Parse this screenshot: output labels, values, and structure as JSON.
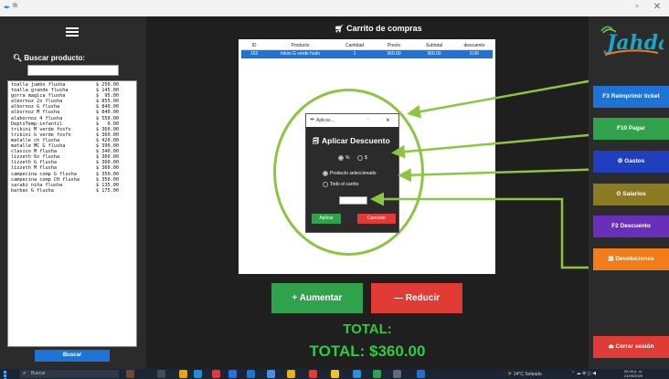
{
  "window": {
    "title": "tk",
    "minimize_label": "▫",
    "close_label": "✕"
  },
  "sidebar_left": {
    "search_label": "Buscar producto:",
    "search_value": "",
    "products": [
      {
        "name": "toalla jumbo flusha",
        "price": "$ 250.00"
      },
      {
        "name": "toalla grande flusha",
        "price": "$ 145.00"
      },
      {
        "name": "gorra magica flusha",
        "price": "$  95.00"
      },
      {
        "name": "albornoz 2x flusha",
        "price": "$ 855.00"
      },
      {
        "name": "albornoz G flusha",
        "price": "$ 840.00"
      },
      {
        "name": "albornoz M flusha",
        "price": "$ 840.00"
      },
      {
        "name": "alabornoz 4 flusha",
        "price": "$ 550.00"
      },
      {
        "name": "DeptoTemp-infantil",
        "price": "$   0.00"
      },
      {
        "name": "trikini M  verde fosfo",
        "price": "$ 360.00"
      },
      {
        "name": "trikini G verde fosfo",
        "price": "$ 360.00"
      },
      {
        "name": "matalle ch flusha",
        "price": "$ 420.00"
      },
      {
        "name": "matalle MC G flusha",
        "price": "$ 390.00"
      },
      {
        "name": "clasico M flusha",
        "price": "$ 340.00"
      },
      {
        "name": "lizzeth 6x flusha",
        "price": "$ 360.00"
      },
      {
        "name": "lizzeth G flusha",
        "price": "$ 360.00"
      },
      {
        "name": "lizzeth M flusha",
        "price": "$ 360.00"
      },
      {
        "name": "campecina comp G flusha",
        "price": "$ 350.00"
      },
      {
        "name": "campecina comp CH flusha",
        "price": "$ 350.00"
      },
      {
        "name": "sarabi niña flusha",
        "price": "$ 135.00"
      },
      {
        "name": "barbas G flusha",
        "price": "$ 175.00"
      }
    ],
    "search_button": "Buscar"
  },
  "cart": {
    "title": "Carrito de compras",
    "columns": [
      "ID",
      "Producto",
      "Cantidad",
      "Precio",
      "Subtotal",
      "descuento"
    ],
    "rows": [
      {
        "id": "153",
        "product": "trikini G verde fosfo",
        "qty": "1",
        "price": "360.00",
        "subtotal": "360.00",
        "discount": "0.00"
      }
    ],
    "increase_button": "+ Aumentar",
    "decrease_button": "— Reducir",
    "total_label": "TOTAL:",
    "total_value": "TOTAL: $360.00"
  },
  "dialog": {
    "window_title": "Aplicar...",
    "heading": "Aplicar Descuento",
    "type_percent": "%",
    "type_amount": "$",
    "scope_selected": "Producto seleccionado",
    "scope_cart": "Todo el carrito",
    "value": "",
    "apply_button": "Aplicar",
    "cancel_button": "Cancelar"
  },
  "sidebar_right": {
    "logo_text": "Jahda",
    "buttons": [
      {
        "label": "F3 Reimprimir ticket",
        "color": "#1e74d6"
      },
      {
        "label": "F10 Pagar",
        "color": "#31a24c"
      },
      {
        "label": "Gastos",
        "color": "#1f3fbf"
      },
      {
        "label": "Salarios",
        "color": "#8a7a22"
      },
      {
        "label": "F2 Descuento",
        "color": "#6a2fb8"
      },
      {
        "label": "Devoluciones",
        "color": "#f07c1a"
      },
      {
        "label": "Cerrar sesión",
        "color": "#e03b35"
      }
    ]
  },
  "taskbar": {
    "search_placeholder": "Buscar",
    "weather": "14°C  Soleado",
    "time": "05:44 p. m.",
    "date": "21/05/2025"
  },
  "colors": {
    "highlight": "#8cc640",
    "total_green": "#2ecc40",
    "accent_blue": "#1e74d6"
  }
}
